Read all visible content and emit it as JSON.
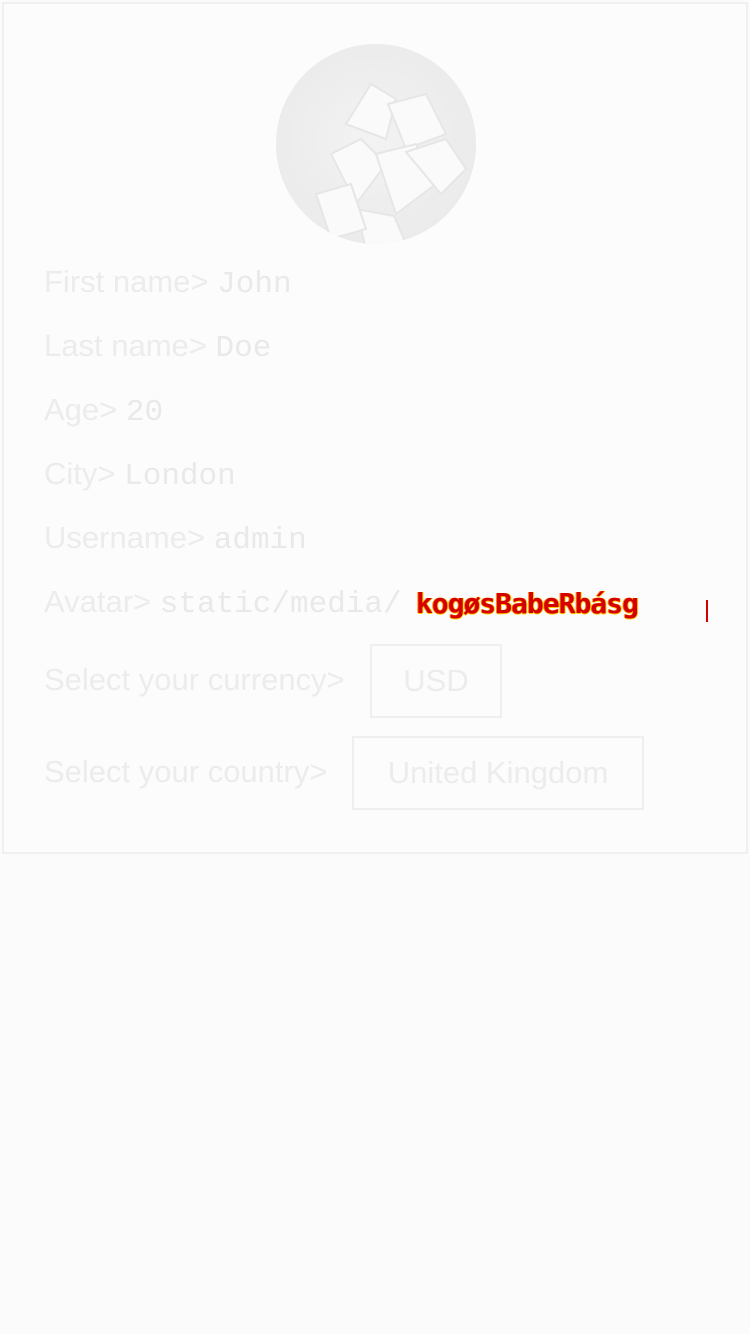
{
  "profile": {
    "first_name_label": "First name>",
    "first_name_value": "John",
    "last_name_label": "Last name>",
    "last_name_value": "Doe",
    "age_label": "Age>",
    "age_value": "20",
    "city_label": "City>",
    "city_value": "London",
    "username_label": "Username>",
    "username_value": "admin",
    "avatar_label": "Avatar>",
    "avatar_value": "static/media/",
    "avatar_glitch_text": "kogøsBabeRbásg"
  },
  "currency": {
    "label": "Select your currency>",
    "selected": "USD"
  },
  "country": {
    "label": "Select your country>",
    "selected": "United Kingdom"
  },
  "icons": {
    "avatar_image": "mango-image"
  }
}
